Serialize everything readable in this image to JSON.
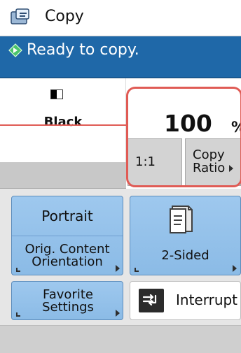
{
  "app": {
    "title": "Copy",
    "status": "Ready to copy."
  },
  "copy": {
    "color_mode": "Black",
    "ratio_value": "100",
    "ratio_unit": "%",
    "one_to_one": "1:1",
    "copy_ratio_line1": "Copy",
    "copy_ratio_line2": "Ratio"
  },
  "buttons": {
    "portrait": "Portrait",
    "orientation_line1": "Orig. Content",
    "orientation_line2": "Orientation",
    "two_sided": "2-Sided",
    "favorite_line1": "Favorite",
    "favorite_line2": "Settings",
    "interrupt": "Interrupt"
  },
  "icons": {
    "title": "copy-document-icon",
    "status": "ready-status-icon",
    "color": "black-mode-icon",
    "two_sided": "two-sided-document-icon",
    "interrupt": "interrupt-arrow-icon"
  },
  "colors": {
    "status_bg": "#1f68a8",
    "highlight": "#e05b55",
    "button_blue": "#9ec8ee"
  }
}
